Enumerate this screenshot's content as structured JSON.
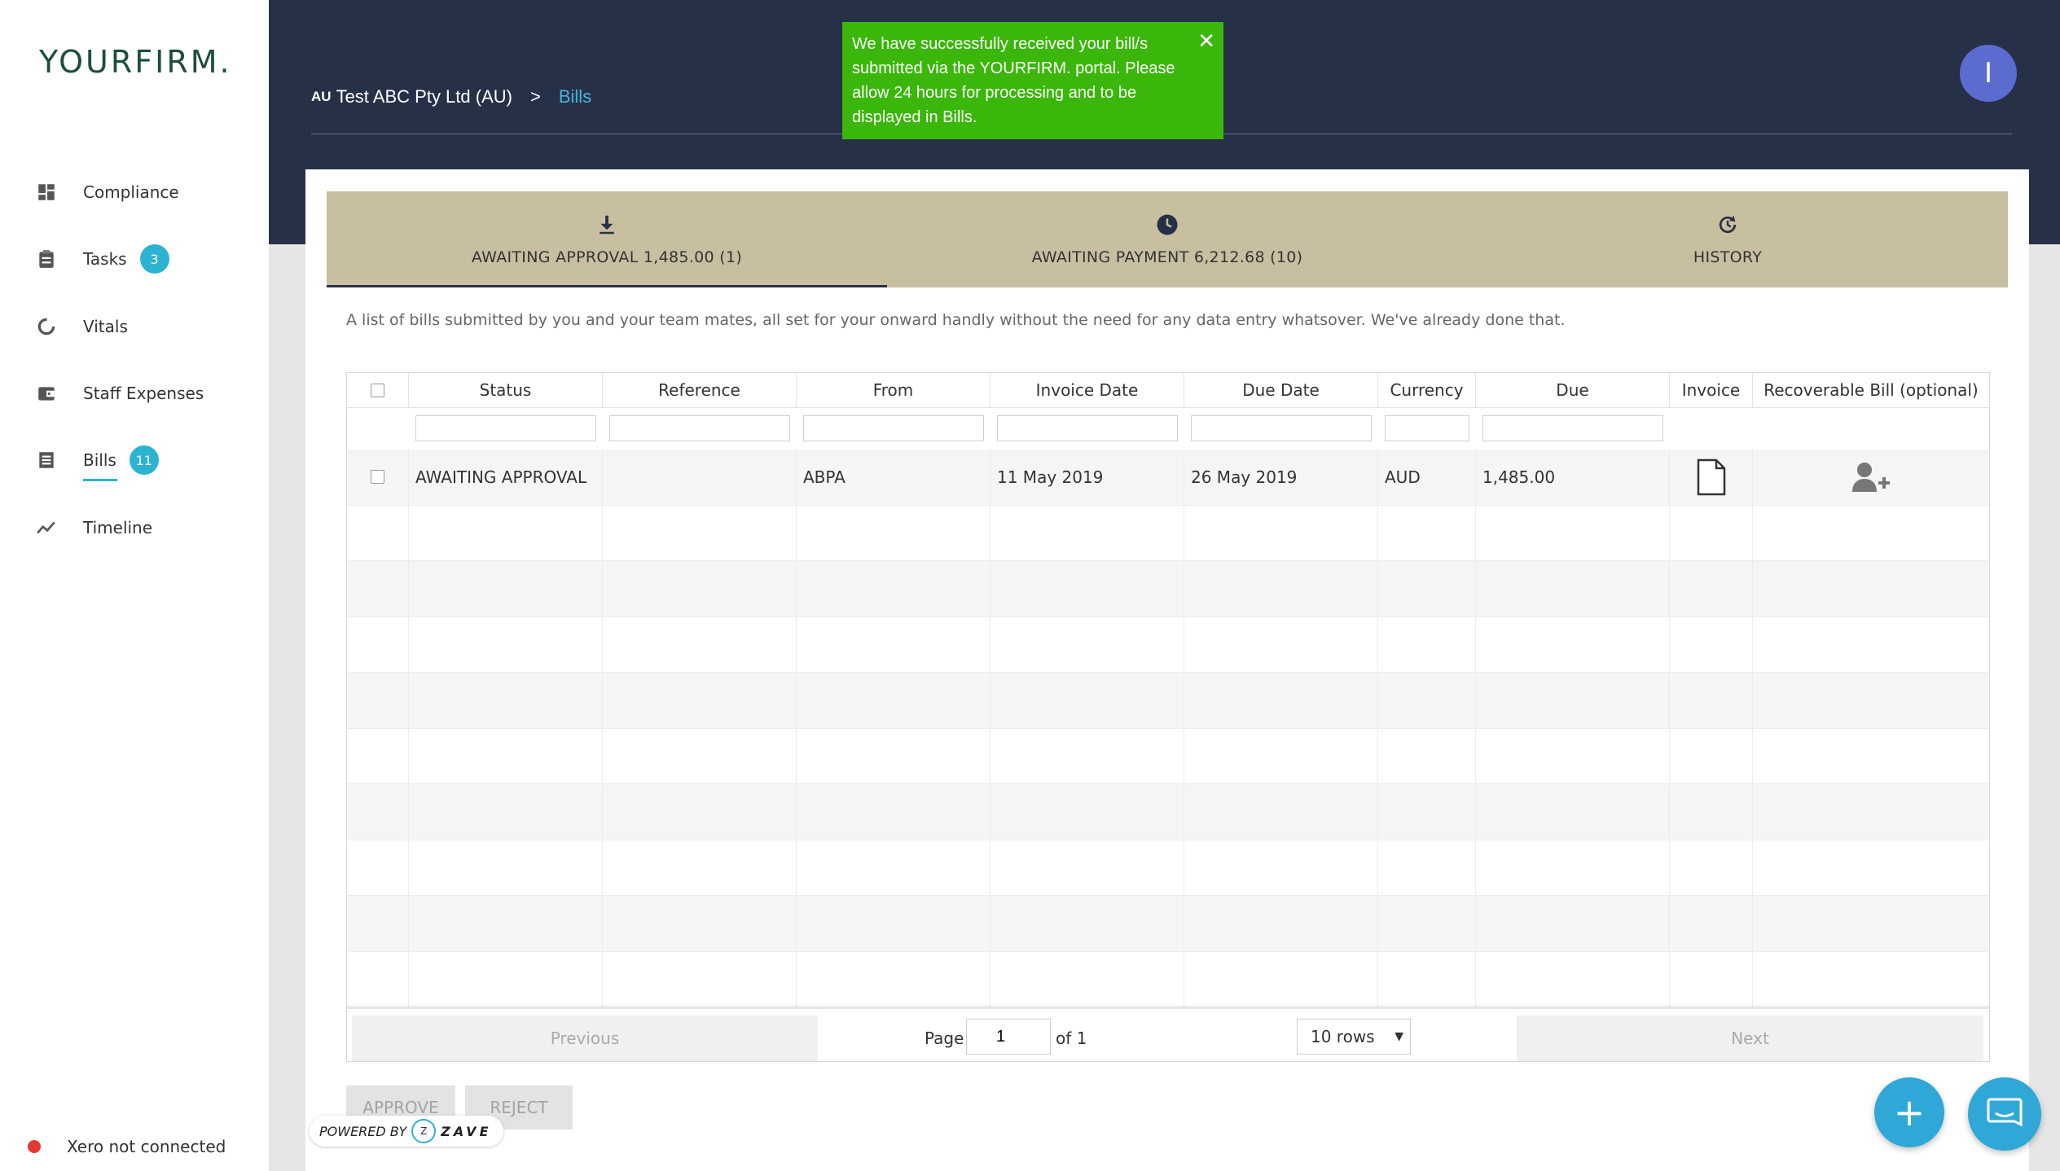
{
  "sidebar": {
    "logo": "YOURFIRM.",
    "items": [
      {
        "label": "Compliance",
        "icon": "dashboard-icon"
      },
      {
        "label": "Tasks",
        "icon": "clipboard-icon",
        "badge": "3"
      },
      {
        "label": "Vitals",
        "icon": "donut-chart-icon"
      },
      {
        "label": "Staff Expenses",
        "icon": "wallet-icon"
      },
      {
        "label": "Bills",
        "icon": "receipt-icon",
        "badge": "11",
        "active": true
      },
      {
        "label": "Timeline",
        "icon": "line-chart-icon"
      }
    ],
    "xero_status": "Xero not connected"
  },
  "header": {
    "breadcrumb": {
      "country": "AU",
      "company": "Test ABC Pty Ltd (AU)",
      "separator": ">",
      "current": "Bills"
    },
    "avatar_initial": "I",
    "toast": {
      "message": "We have successfully received your bill/s submitted via the YOURFIRM. portal. Please allow 24 hours for processing and to be displayed in Bills.",
      "close": "✕"
    }
  },
  "tabs": [
    {
      "label": "AWAITING APPROVAL 1,485.00 (1)",
      "icon": "download-icon",
      "active": true
    },
    {
      "label": "AWAITING PAYMENT 6,212.68 (10)",
      "icon": "clock-icon"
    },
    {
      "label": "HISTORY",
      "icon": "history-icon"
    }
  ],
  "description": "A list of bills submitted by you and your team mates, all set for your onward handly without the need for any data entry whatsover. We've already done that.",
  "table": {
    "columns": [
      "Status",
      "Reference",
      "From",
      "Invoice Date",
      "Due Date",
      "Currency",
      "Due",
      "Invoice",
      "Recoverable Bill (optional)"
    ],
    "rows": [
      {
        "status": "AWAITING APPROVAL",
        "reference": "",
        "from": "ABPA",
        "invoice_date": "11 May 2019",
        "due_date": "26 May 2019",
        "currency": "AUD",
        "due": "1,485.00"
      }
    ],
    "empty_rows": 9
  },
  "pagination": {
    "previous": "Previous",
    "page_label": "Page",
    "page_value": "1",
    "of_label": "of 1",
    "rows_select": "10 rows",
    "next": "Next"
  },
  "actions": {
    "approve": "APPROVE",
    "reject": "REJECT"
  },
  "powered_by": {
    "label": "POWERED BY",
    "brand": "ZAVE"
  },
  "fab": {
    "plus": "+"
  },
  "colors": {
    "accent": "#2cb3d1",
    "header_bg": "#263148",
    "tab_bg": "#c8bfa0",
    "toast_bg": "#3ab70a",
    "avatar_bg": "#5b6bd0"
  }
}
